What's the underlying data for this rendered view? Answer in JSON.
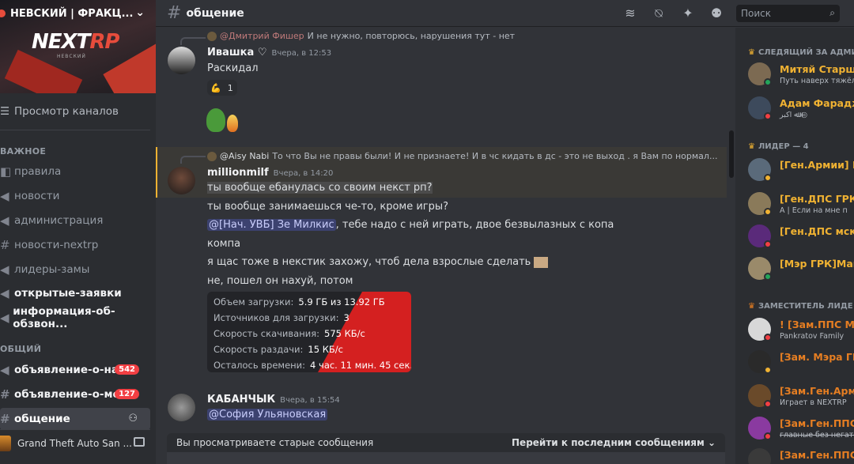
{
  "server": {
    "name": "НЕВСКИЙ | ФРАКЦ...",
    "logo_text": "NEXTRP",
    "logo_sub": "НЕВСКИЙ"
  },
  "sidebar": {
    "browse_label": "Просмотр каналов",
    "categories": [
      {
        "label": "ВАЖНОЕ"
      },
      {
        "label": "ОБЩИЙ"
      }
    ],
    "channels": [
      {
        "label": "правила"
      },
      {
        "label": "новости"
      },
      {
        "label": "администрация"
      },
      {
        "label": "новости-nextrp"
      },
      {
        "label": "лидеры-замы"
      },
      {
        "label": "открытые-заявки"
      },
      {
        "label": "информация-об-обзвон..."
      },
      {
        "label": "объявление-о-на...",
        "badge": "542"
      },
      {
        "label": "объявление-о-ме...",
        "badge": "127"
      },
      {
        "label": "общение"
      }
    ],
    "game_activity": "Grand Theft Auto San ..."
  },
  "topbar": {
    "channel": "общение",
    "search_placeholder": "Поиск"
  },
  "messages": {
    "m1": {
      "reply_author": "@Дмитрий Фишер",
      "reply_text": "И не нужно, повторюсь, нарушения тут - нет",
      "author": "Ивашка",
      "author_badge": "♡",
      "timestamp": "Вчера, в 12:53",
      "text": "Раскидал",
      "reaction_count": "1"
    },
    "m2": {
      "reply_author": "@Aisy Nabi",
      "reply_text": "То что Вы не правы были! И не признаете! И в чс кидать в дс - это не выход . я Вам по нормал...",
      "author": "millionmilf",
      "timestamp": "Вчера, в 14:20",
      "lines": [
        "ты вообще ебанулась со своим некст рп?",
        "ты вообще занимаешься че-то, кроме игры?",
        ", тебе надо с ней играть, двое безвылазных с копа",
        "компа",
        "я щас тоже в некстик захожу, чтоб дела взрослые сделать",
        "не, пошел он нахуй, потом"
      ],
      "mention": "@[Нач. УВБ] Зе Милкис"
    },
    "embed": {
      "rows": [
        {
          "label": "Объем загрузки:",
          "value": "5.9 ГБ из 13.92 ГБ"
        },
        {
          "label": "Источников для загрузки:",
          "value": "3"
        },
        {
          "label": "Скорость скачивания:",
          "value": "575 КБ/с"
        },
        {
          "label": "Скорость раздачи:",
          "value": "15 КБ/с"
        },
        {
          "label": "Осталось времени:",
          "value": "4 час. 11 мин. 45 сек."
        }
      ]
    },
    "m3": {
      "author": "КАБАНЧЫК",
      "timestamp": "Вчера, в 15:54",
      "mention": "@София Ульяновская"
    }
  },
  "old_messages_bar": {
    "text": "Вы просматриваете старые сообщения",
    "jump_label": "Перейти к последним сообщениям"
  },
  "members": {
    "sections": [
      {
        "label": "СЛЕДЯЩИЙ ЗА АДМИ"
      },
      {
        "label": "ЛИДЕР — 4"
      },
      {
        "label": "ЗАМЕСТИТЕЛЬ ЛИДЕ"
      }
    ],
    "list": [
      {
        "name": "Митяй Старши",
        "status_text": "Путь наверх тяжёл,",
        "color": "#f0b232",
        "status": "online"
      },
      {
        "name": "Адам Фарадж",
        "status_text": "ﷲ اکبر ◎",
        "color": "#f0b232",
        "status": "dnd"
      },
      {
        "name": "[Ген.Армии] Ва",
        "status_text": "",
        "color": "#f0b232",
        "status": "idle"
      },
      {
        "name": "[Ген.ДПС ГРК]",
        "status_text": "A | Если на мне п",
        "color": "#f0b232",
        "status": "idle"
      },
      {
        "name": "[Ген.ДПС мск]",
        "status_text": "",
        "color": "#f0b232",
        "status": "dnd"
      },
      {
        "name": "[Мэр ГРК]Маго",
        "status_text": "",
        "color": "#f0b232",
        "status": "online"
      },
      {
        "name": "! [Зам.ППС МС",
        "status_text": "Pankratov Family",
        "color": "#e67e22",
        "status": "dnd"
      },
      {
        "name": "[Зам. Мэра ГР",
        "status_text": "",
        "color": "#e67e22",
        "status": "idle"
      },
      {
        "name": "[Зам.Ген.Армия",
        "status_text": "Играет в NEXTRP",
        "color": "#e67e22",
        "status": "dnd"
      },
      {
        "name": "[Зам.Ген.ППС I",
        "status_text": "главные без негати",
        "color": "#e67e22",
        "status": "dnd"
      },
      {
        "name": "[Зам.Ген.ППС I",
        "status_text": "",
        "color": "#e67e22",
        "status": "dnd"
      }
    ]
  }
}
